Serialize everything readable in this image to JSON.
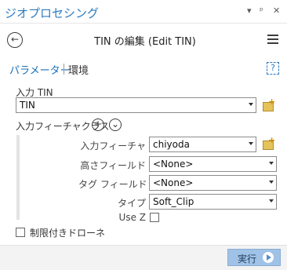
{
  "pane": {
    "title": "ジオプロセシング",
    "icons": [
      "chevron-down-icon",
      "pin-icon",
      "close-icon"
    ]
  },
  "header": {
    "tool_title": "TIN の編集 (Edit TIN)",
    "back_icon": "back-arrow-icon",
    "menu_icon": "hamburger-menu-icon"
  },
  "tabs": {
    "parameters": "パラメーター",
    "environments": "環境",
    "help_icon": "?"
  },
  "params": {
    "input_tin_label": "入力 TIN",
    "input_tin_value": "TIN",
    "input_fc_label": "入力フィーチャクラス",
    "fc_row": {
      "input_features_label": "入力フィーチャ",
      "input_features_value": "chiyoda",
      "height_field_label": "高さフィールド",
      "height_field_value": "<None>",
      "tag_field_label": "タグ フィールド",
      "tag_field_value": "<None>",
      "type_label": "タイプ",
      "type_value": "Soft_Clip",
      "use_z_label": "Use Z",
      "use_z_checked": false
    },
    "constrained_delaunay_label": "制限付きドローネ",
    "constrained_delaunay_checked": false
  },
  "footer": {
    "run_label": "実行"
  },
  "colors": {
    "accent": "#2b7bc2",
    "run_button": "#9fc2e6"
  }
}
